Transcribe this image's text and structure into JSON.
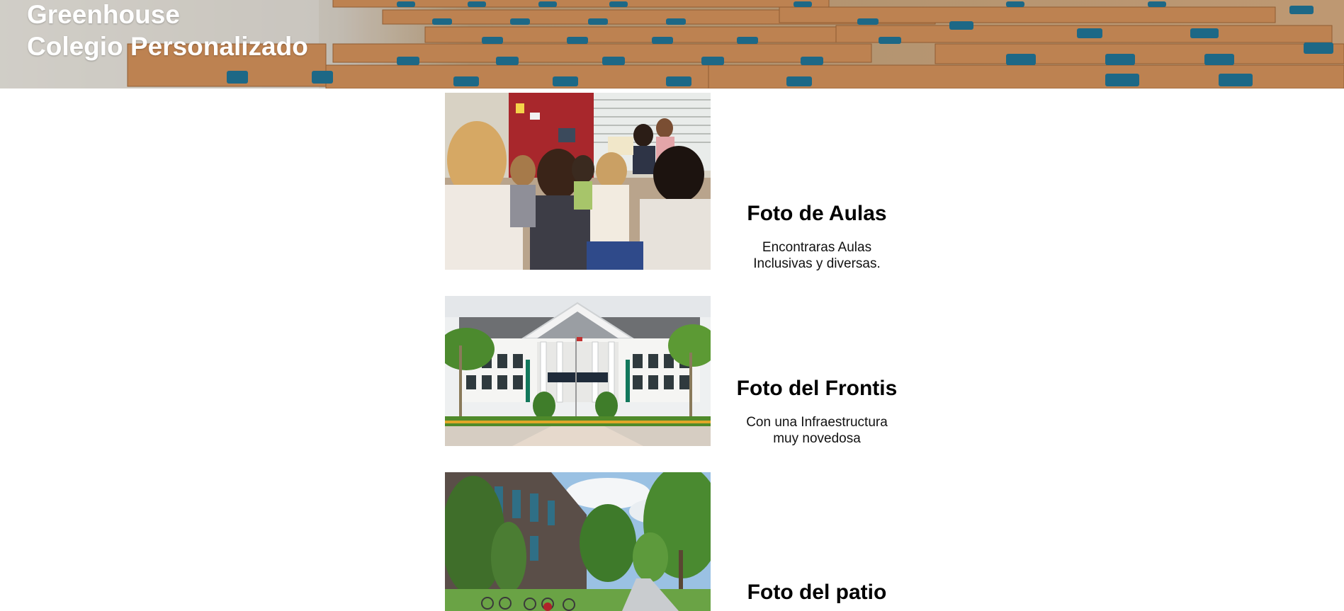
{
  "header": {
    "title_line1": "Greenhouse",
    "title_line2": "Colegio Personalizado",
    "background_image": "lecture-hall-photo"
  },
  "gallery": [
    {
      "title": "Foto de Aulas",
      "description_line1": "Encontraras Aulas",
      "description_line2": "Inclusivas y diversas.",
      "image": "classroom-children-photo"
    },
    {
      "title": "Foto del Frontis",
      "description_line1": "Con una Infraestructura",
      "description_line2": "muy novedosa",
      "image": "building-facade-photo"
    },
    {
      "title": "Foto del patio",
      "description_line1": "",
      "description_line2": "",
      "image": "campus-courtyard-photo"
    }
  ],
  "colors": {
    "background": "#ffffff",
    "header_text": "#ffffff",
    "heading_text": "#000000"
  }
}
